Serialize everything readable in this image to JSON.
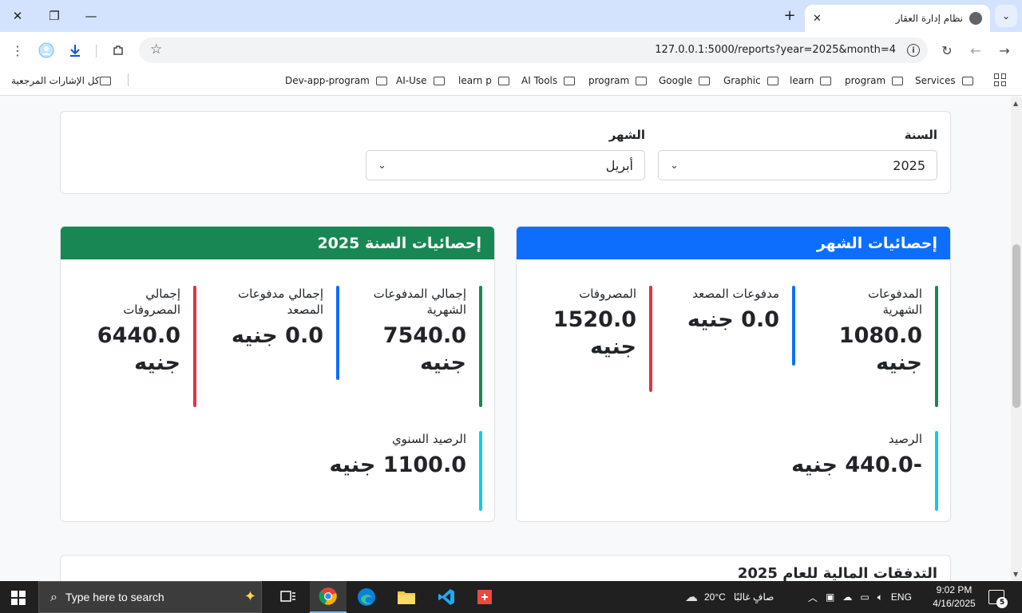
{
  "browser": {
    "tab_title": "نظام إدارة العقار",
    "url": "127.0.0.1:5000/reports?year=2025&month=4",
    "bookmarks": [
      "Services",
      "program",
      "learn",
      "Graphic",
      "Google",
      "program",
      "AI Tools",
      "learn p",
      "AI-Use",
      "Dev-app-program"
    ],
    "all_bookmarks": "كل الإشارات المرجعية"
  },
  "filters": {
    "year_label": "السنة",
    "year_value": "2025",
    "month_label": "الشهر",
    "month_value": "أبريل"
  },
  "monthly": {
    "title": "إحصائيات الشهر",
    "header_color": "#0d6efd",
    "payments_label": "المدفوعات الشهرية",
    "payments_value": "1080.0 جنيه",
    "elevator_label": "مدفوعات المصعد",
    "elevator_value": "0.0 جنيه",
    "expenses_label": "المصروفات",
    "expenses_value": "1520.0 جنيه",
    "balance_label": "الرصيد",
    "balance_value": "-440.0 جنيه"
  },
  "yearly": {
    "title": "إحصائيات السنة 2025",
    "header_color": "#198754",
    "payments_label": "إجمالي المدفوعات الشهرية",
    "payments_value": "7540.0 جنيه",
    "elevator_label": "إجمالي مدفوعات المصعد",
    "elevator_value": "0.0 جنيه",
    "expenses_label": "إجمالي المصروفات",
    "expenses_value": "6440.0 جنيه",
    "balance_label": "الرصيد السنوي",
    "balance_value": "1100.0 جنيه"
  },
  "bar_colors": {
    "payments": "#198754",
    "elevator": "#0d6efd",
    "expenses": "#dc3545",
    "balance": "#0dcaf0"
  },
  "cashflow_title": "التدفقات المالية للعام 2025",
  "taskbar": {
    "search_placeholder": "Type here to search",
    "weather_temp": "20°C",
    "weather_desc": "صافٍ غالبًا",
    "language": "ENG",
    "time": "9:02 PM",
    "date": "4/16/2025",
    "notification_count": "5"
  }
}
